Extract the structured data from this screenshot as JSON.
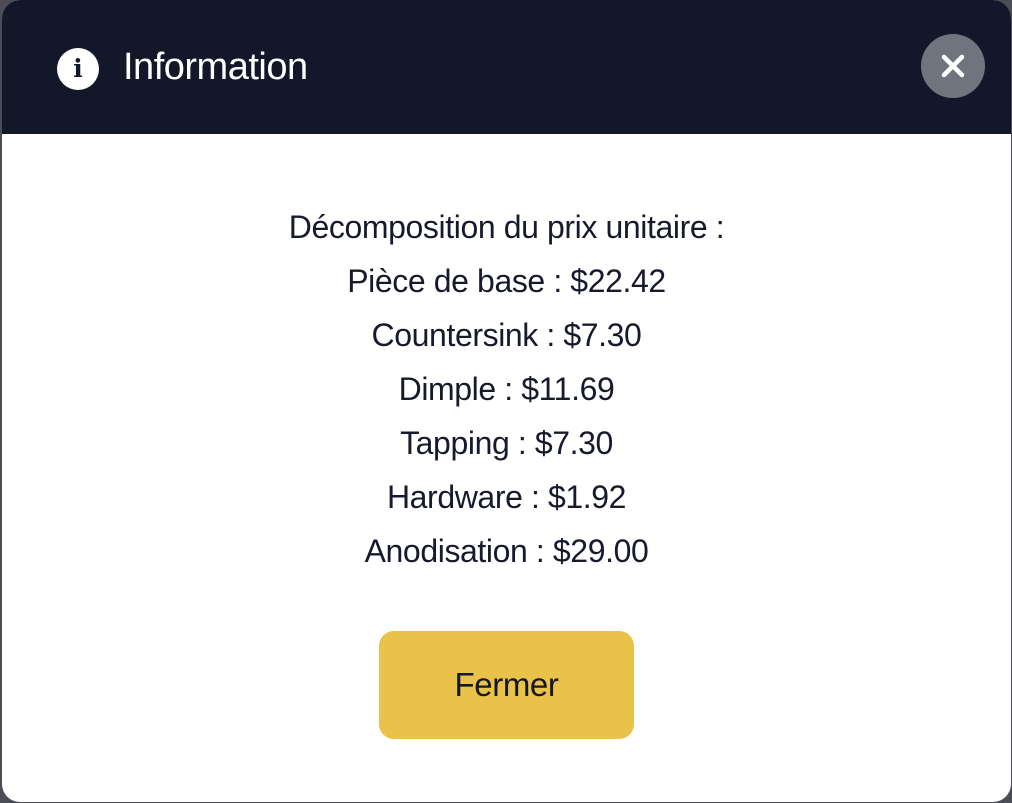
{
  "dialog": {
    "title": "Information",
    "header_background": "#12182a",
    "accent_color": "#e9c24a",
    "icons": {
      "title_icon": "info-circle-icon",
      "close_icon": "close-icon"
    },
    "message_lines": [
      "Décomposition du prix unitaire :",
      "Pièce de base : $22.42",
      "Countersink : $7.30",
      "Dimple : $11.69",
      "Tapping : $7.30",
      "Hardware : $1.92",
      "Anodisation : $29.00"
    ],
    "close_button_label": "Fermer"
  }
}
